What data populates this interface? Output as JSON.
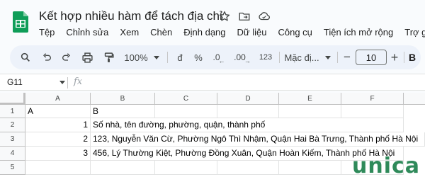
{
  "app": {
    "doc_title": "Kết hợp nhiều hàm để tách địa chỉ"
  },
  "menu": [
    "Tệp",
    "Chỉnh sửa",
    "Xem",
    "Chèn",
    "Định dạng",
    "Dữ liệu",
    "Công cụ",
    "Tiện ích mở rộng",
    "Trợ giúp"
  ],
  "toolbar": {
    "zoom": "100%",
    "currency": "đ",
    "percent": "%",
    "decrease_decimal": ".0",
    "increase_decimal": ".00",
    "number_format": "123",
    "font_name": "Mặc đị...",
    "font_size": "10",
    "minus": "−",
    "plus": "+",
    "bold": "B"
  },
  "formula_bar": {
    "cell_ref": "G11",
    "fx": "fx",
    "value": ""
  },
  "sheet": {
    "columns": [
      "A",
      "B",
      "C",
      "D",
      "E",
      "F"
    ],
    "rows": [
      "1",
      "2",
      "3",
      "4",
      "5"
    ],
    "cells": {
      "A1": "A",
      "B1": "B",
      "A2": "1",
      "B2": "Số nhà, tên đường, phường, quận, thành phố",
      "A3": "2",
      "B3": "123, Nguyễn Văn Cừ, Phường Ngô Thì Nhậm, Quận Hai Bà Trưng, Thành phố Hà Nội",
      "A4": "3",
      "B4": "456, Lý Thường Kiệt, Phường Đồng Xuân, Quận Hoàn Kiếm, Thành phố Hà Nội"
    }
  },
  "watermark": {
    "text_main": "unica"
  },
  "colors": {
    "sheets_green": "#0f9d58",
    "toolbar_bg": "#edf2fa",
    "header_bg": "#f8f9fa"
  }
}
